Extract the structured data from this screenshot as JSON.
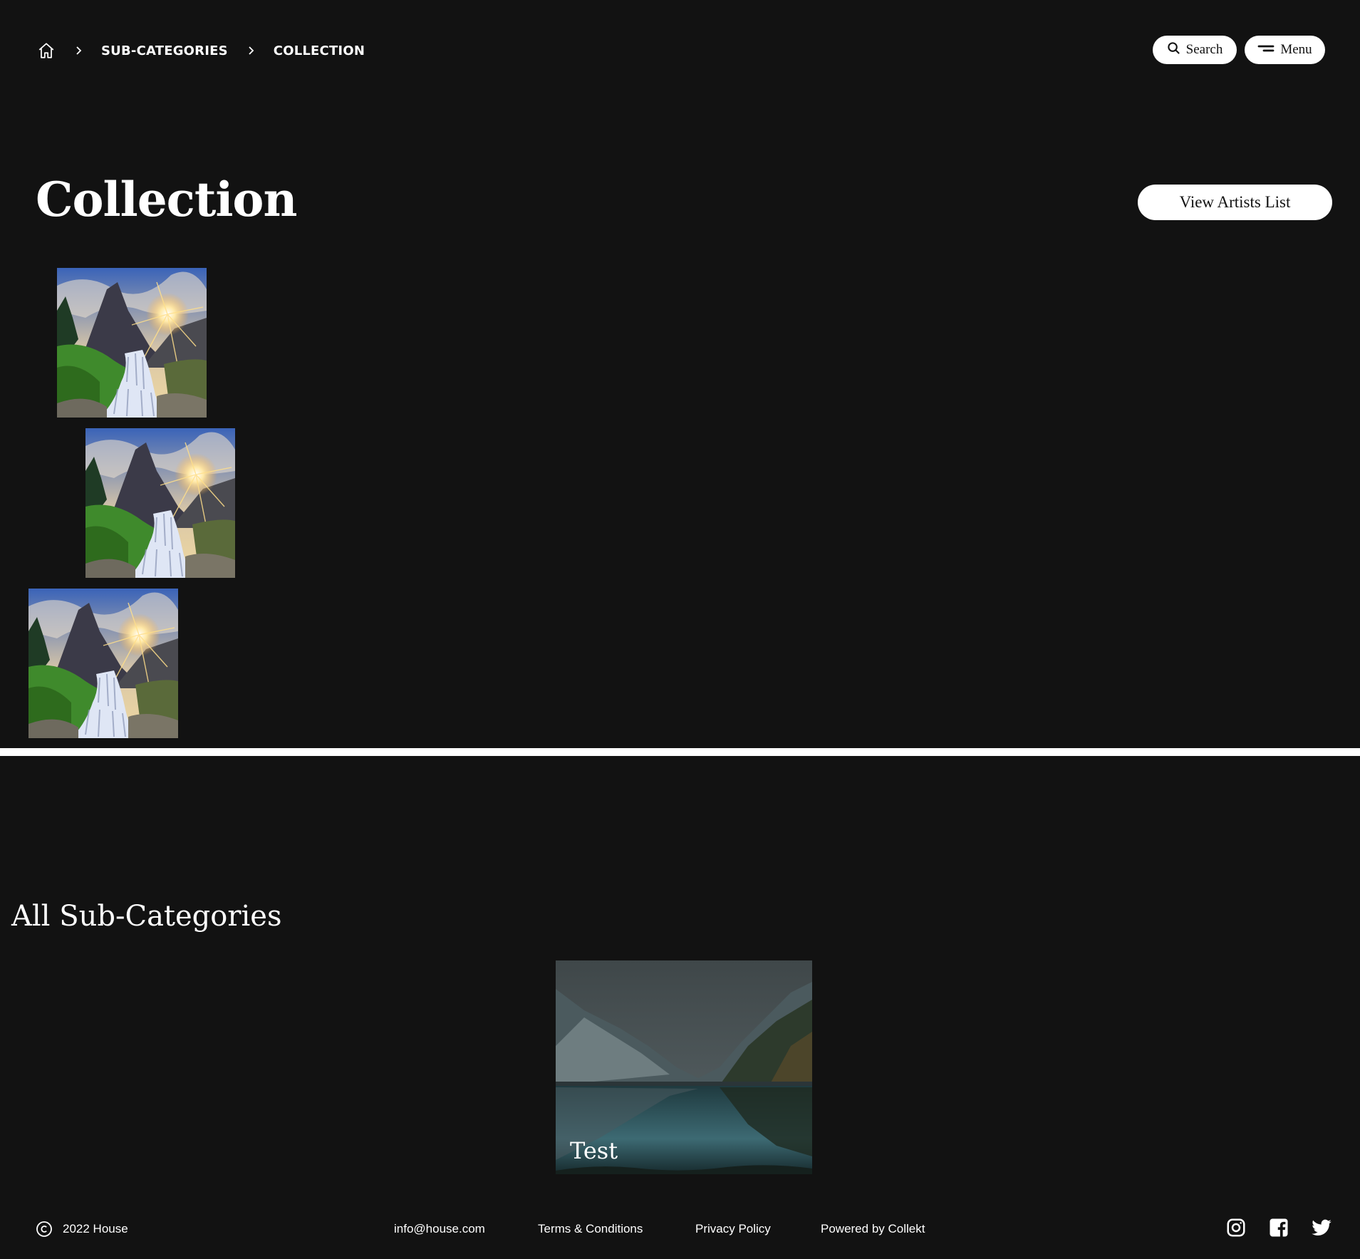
{
  "breadcrumb": {
    "home_icon": "home-icon",
    "separator_icon": "chevron-right-icon",
    "items": [
      "SUB-CATEGORIES",
      "COLLECTION"
    ]
  },
  "header": {
    "search_label": "Search",
    "search_icon": "search-icon",
    "menu_label": "Menu",
    "menu_icon": "menu-icon"
  },
  "main": {
    "title": "Collection",
    "view_artists_label": "View Artists List",
    "artworks": [
      {
        "image": "waterfall-mountain-sunset"
      },
      {
        "image": "waterfall-mountain-sunset"
      },
      {
        "image": "waterfall-mountain-sunset"
      }
    ]
  },
  "subcategories": {
    "title": "All Sub-Categories",
    "items": [
      {
        "label": "Test",
        "image": "mountain-lake-reflection"
      }
    ]
  },
  "footer": {
    "copyright_icon": "copyright-icon",
    "copyright": "2022 House",
    "email": "info@house.com",
    "terms": "Terms & Conditions",
    "privacy": "Privacy Policy",
    "powered": "Powered by Collekt",
    "social_icons": [
      "instagram-icon",
      "facebook-icon",
      "twitter-icon"
    ]
  },
  "colors": {
    "background": "#121212",
    "foreground": "#ffffff",
    "button_text": "#111111"
  }
}
